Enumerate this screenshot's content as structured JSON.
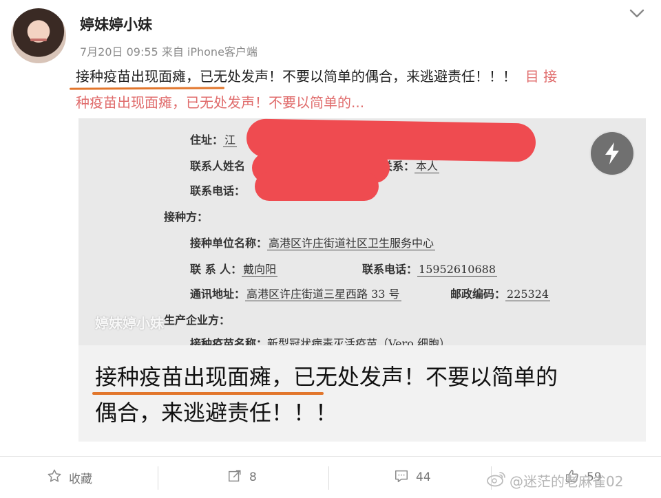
{
  "user": {
    "name": "婷妹婷小妹"
  },
  "post": {
    "meta": "7月20日 09:55 来自 iPhone客户端",
    "text_line1": "接种疫苗出现面瘫，已无处发声！不要以简单的偶合，来逃避责任！！！",
    "link_prefix": "目 接",
    "text_line2": "种疫苗出现面瘫，已无处发声！不要以简单的..."
  },
  "document": {
    "address_label": "住址：",
    "address_value": "江",
    "contact_name_label": "联系人姓名",
    "relation_label": "关系：",
    "relation_value": "本人",
    "phone_label": "联系电话：",
    "vaccination_party_label": "接种方：",
    "unit_label": "接种单位名称：",
    "unit_value": "高港区许庄街道社区卫生服务中心",
    "contact_label": "联 系 人：",
    "contact_value": "戴向阳",
    "contact_phone_label": "联系电话：",
    "contact_phone_value": "15952610688",
    "mail_address_label": "通讯地址：",
    "mail_address_value": "高港区许庄街道三星西路 33 号",
    "postcode_label": "邮政编码：",
    "postcode_value": "225324",
    "manufacturer_label": "生产企业方：",
    "vaccine_name_label": "接种疫苗名称：",
    "vaccine_name_value": "新型冠状病毒灭活疫苗（Vero 细胞）",
    "watermark": "婷妹婷小妹"
  },
  "caption": {
    "line1": "接种疫苗出现面瘫，已无处发声！不要以简单的",
    "line2": "偶合，来逃避责任！！！"
  },
  "actions": {
    "favorite_label": "收藏",
    "repost_count": "8",
    "comment_count": "44",
    "like_count": "59",
    "watermark": "@迷茫的老麻雀02"
  },
  "colors": {
    "accent_underline": "#e2762c",
    "redaction": "#ef4b50",
    "link": "#e06c6c"
  }
}
